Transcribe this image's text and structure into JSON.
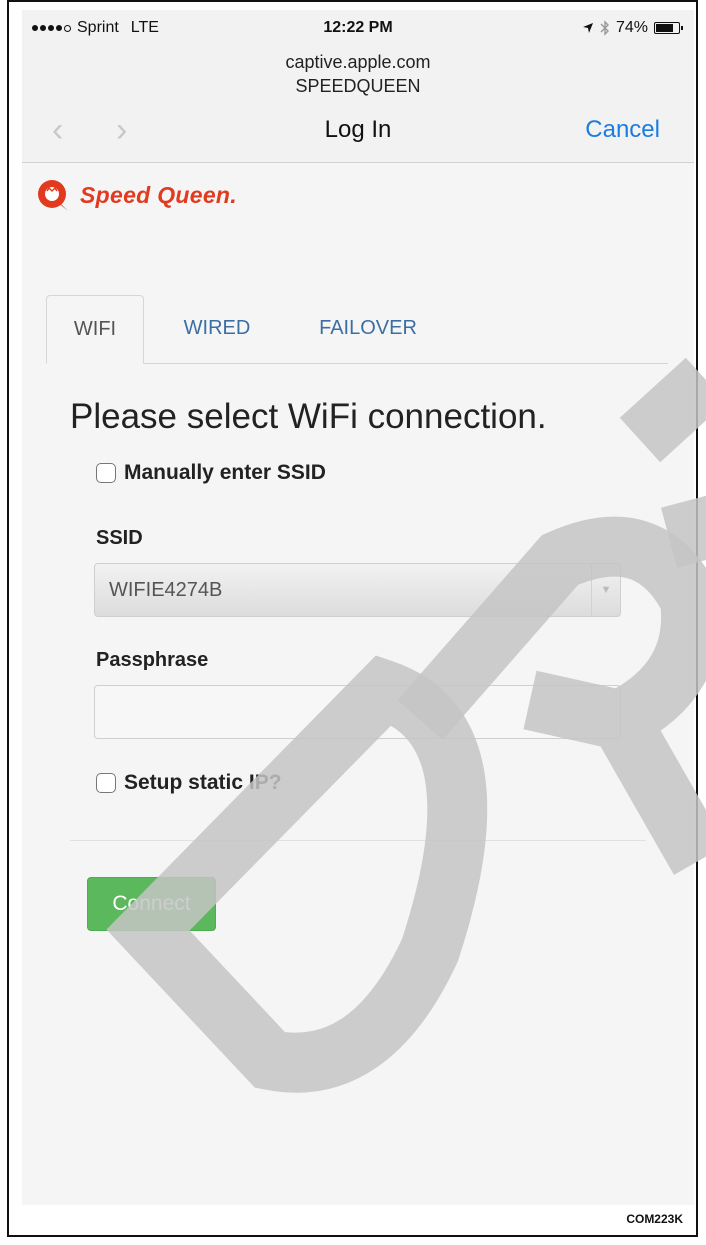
{
  "status_bar": {
    "carrier": "Sprint",
    "network": "LTE",
    "time": "12:22 PM",
    "battery": "74%",
    "battery_level": 0.74,
    "icons": [
      "signal-dots-icon",
      "location-arrow-icon",
      "bluetooth-icon",
      "battery-icon"
    ]
  },
  "browser": {
    "url": "captive.apple.com",
    "network_name": "SPEEDQUEEN",
    "title": "Log In",
    "cancel": "Cancel"
  },
  "brand": {
    "name": "Speed Queen.",
    "color": "#e13a1e"
  },
  "tabs": [
    {
      "label": "WIFI",
      "active": true
    },
    {
      "label": "WIRED",
      "active": false
    },
    {
      "label": "FAILOVER",
      "active": false
    }
  ],
  "form": {
    "heading": "Please select WiFi connection.",
    "manual_ssid_label": "Manually enter SSID",
    "ssid_label": "SSID",
    "ssid_value": "WIFIE4274B",
    "passphrase_label": "Passphrase",
    "passphrase_value": "",
    "static_ip_label": "Setup static IP?",
    "connect_label": "Connect",
    "connect_color": "#5cb85c"
  },
  "figure_code": "COM223K",
  "watermark": "DRAFT"
}
